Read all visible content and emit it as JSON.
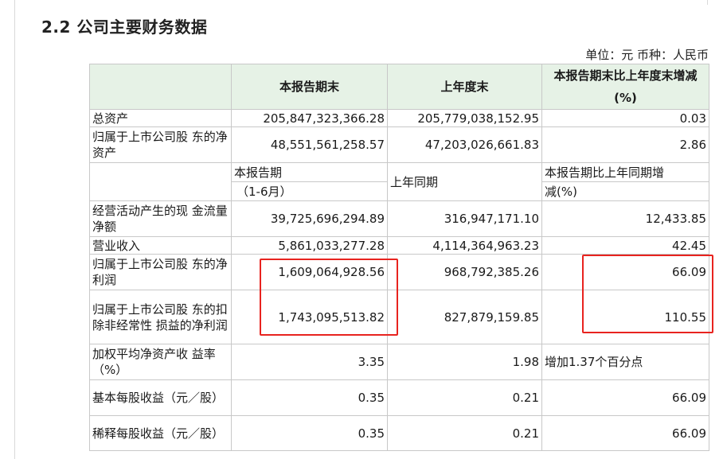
{
  "section_title": "2.2 公司主要财务数据",
  "unit_note": "单位：元 币种：人民币",
  "header": {
    "col1": "本报告期末",
    "col2": "上年度末",
    "col3_line1": "本报告期末比上年度末增减",
    "col3_line2": "(%)"
  },
  "balance_rows": [
    {
      "label": "总资产",
      "current": "205,847,323,366.28",
      "prior": "205,779,038,152.95",
      "change": "0.03"
    },
    {
      "label": "归属于上市公司股 东的净资产",
      "current": "48,551,561,258.57",
      "prior": "47,203,026,661.83",
      "change": "2.86"
    }
  ],
  "period_header": {
    "col1_line1": "本报告期",
    "col1_line2": "（1-6月）",
    "col2": "上年同期",
    "col3_line1": "本报告期比上年同期增",
    "col3_line2": "减(%)"
  },
  "period_rows": [
    {
      "label": "经营活动产生的现 金流量净额",
      "current": "39,725,696,294.89",
      "prior": "316,947,171.10",
      "change": "12,433.85"
    },
    {
      "label": "营业收入",
      "current": "5,861,033,277.28",
      "prior": "4,114,364,963.23",
      "change": "42.45"
    },
    {
      "label": "归属于上市公司股 东的净利润",
      "current": "1,609,064,928.56",
      "prior": "968,792,385.26",
      "change": "66.09"
    },
    {
      "label": "归属于上市公司股 东的扣除非经常性 损益的净利润",
      "current": "1,743,095,513.82",
      "prior": "827,879,159.85",
      "change": "110.55"
    },
    {
      "label": "加权平均净资产收 益率（%）",
      "current": "3.35",
      "prior": "1.98",
      "change": "增加1.37个百分点"
    },
    {
      "label": "基本每股收益（元／股）",
      "current": "0.35",
      "prior": "0.21",
      "change": "66.09"
    },
    {
      "label": "稀释每股收益（元／股）",
      "current": "0.35",
      "prior": "0.21",
      "change": "66.09"
    }
  ]
}
